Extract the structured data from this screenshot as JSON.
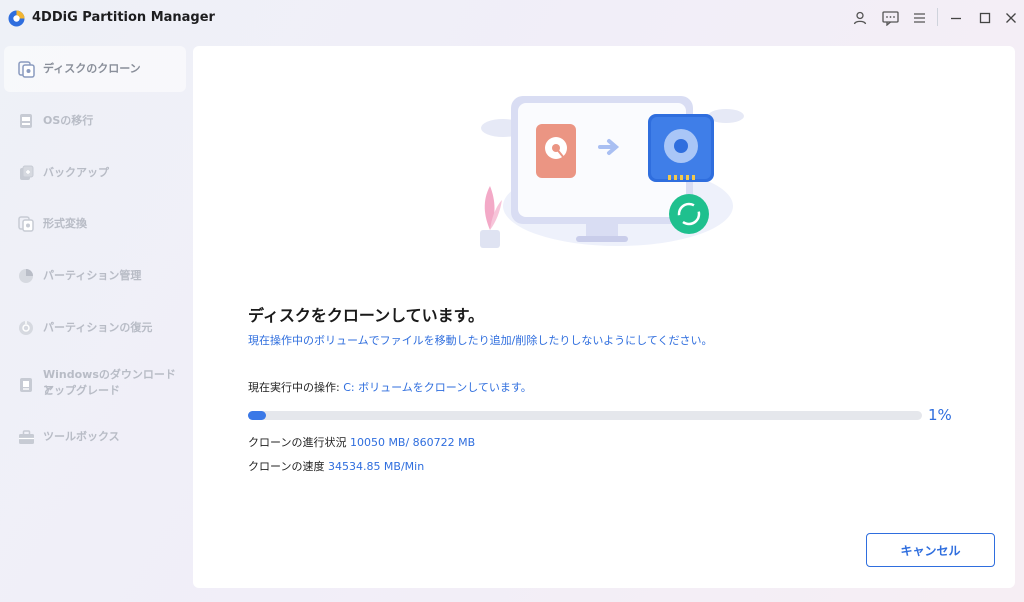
{
  "app": {
    "title": "4DDiG Partition Manager"
  },
  "titlebar": {
    "icons": [
      "user-icon",
      "feedback-icon",
      "menu-icon",
      "minimize-icon",
      "maximize-icon",
      "close-icon"
    ]
  },
  "sidebar": {
    "items": [
      {
        "label": "ディスクのクローン",
        "icon": "disk-clone-icon",
        "active": true
      },
      {
        "label": "OSの移行",
        "icon": "os-migrate-icon",
        "active": false
      },
      {
        "label": "バックアップ",
        "icon": "backup-icon",
        "active": false
      },
      {
        "label": "形式変換",
        "icon": "convert-icon",
        "active": false
      },
      {
        "label": "パーティション管理",
        "icon": "partition-icon",
        "active": false
      },
      {
        "label": "パーティションの復元",
        "icon": "restore-icon",
        "active": false
      },
      {
        "label": "Windowsのダウンロードとアップグレード",
        "label_line1": "Windowsのダウンロードと",
        "label_line2": "アップグレード",
        "icon": "windows-download-icon",
        "active": false
      },
      {
        "label": "ツールボックス",
        "icon": "toolbox-icon",
        "active": false
      }
    ]
  },
  "main": {
    "heading": "ディスクをクローンしています。",
    "warning": "現在操作中のボリュームでファイルを移動したり追加/削除したりしないようにしてください。",
    "operation_label": "現在実行中の操作:",
    "operation_value": "C: ボリュームをクローンしています。",
    "progress": {
      "percent": 1,
      "percent_text": "1%"
    },
    "clone_progress_label": "クローンの進行状況",
    "clone_progress_value": "10050 MB/ 860722 MB",
    "clone_speed_label": "クローンの速度",
    "clone_speed_value": "34534.85 MB/Min",
    "cancel_label": "キャンセル"
  },
  "colors": {
    "accent": "#2f6ede",
    "progress": "#3a78e7",
    "track": "#e5e7ec",
    "clone_badge": "#1fc08e"
  }
}
